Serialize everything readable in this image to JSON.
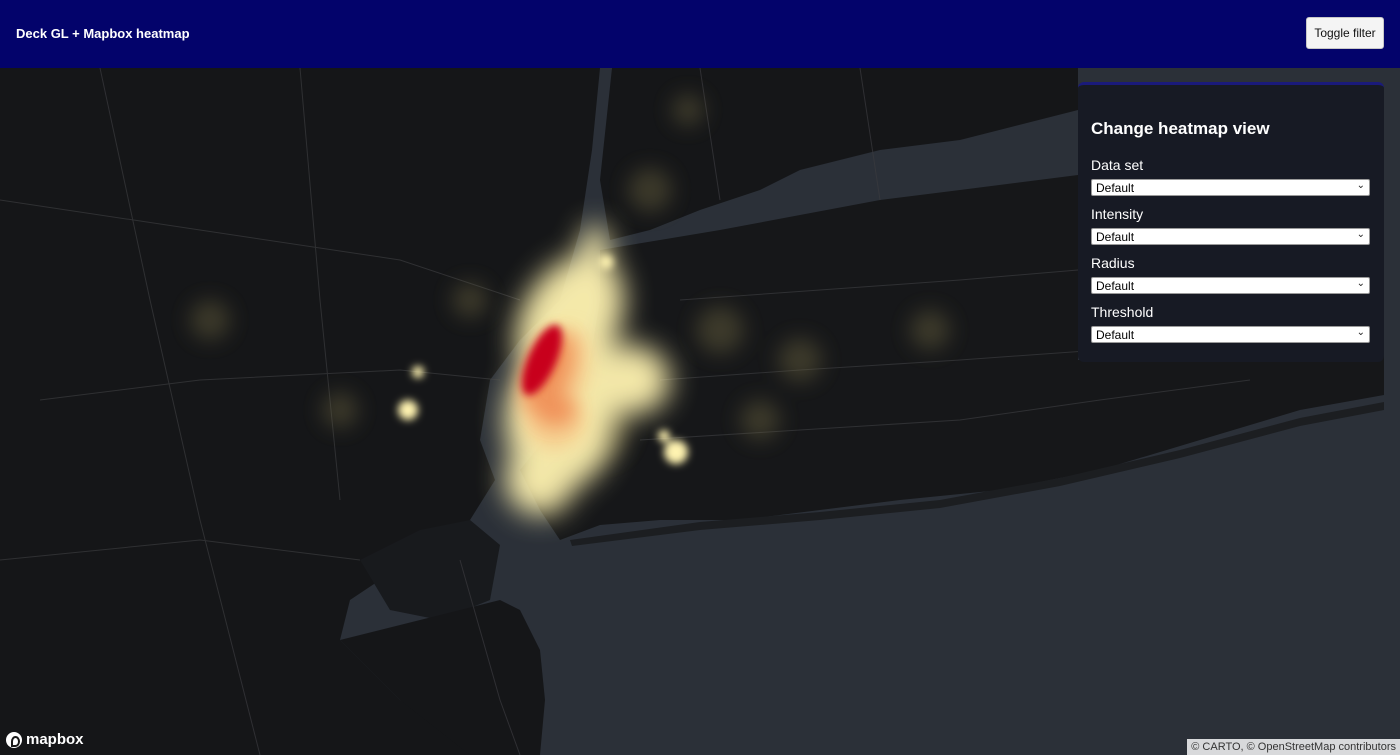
{
  "header": {
    "title": "Deck GL + Mapbox heatmap",
    "toggle_label": "Toggle filter"
  },
  "panel": {
    "title": "Change heatmap view",
    "controls": [
      {
        "label": "Data set",
        "value": "Default"
      },
      {
        "label": "Intensity",
        "value": "Default"
      },
      {
        "label": "Radius",
        "value": "Default"
      },
      {
        "label": "Threshold",
        "value": "Default"
      }
    ]
  },
  "map": {
    "logo_text": "mapbox",
    "attribution": "© CARTO, © OpenStreetMap contributors",
    "colors": {
      "land": "#151618",
      "water": "#2b3038",
      "heat_low": "#fff3b0",
      "heat_mid": "#f4a15a",
      "heat_high": "#c8001e"
    }
  },
  "icons": {
    "logo": "mapbox-logo-icon",
    "dropdown": "chevron-down-icon"
  }
}
